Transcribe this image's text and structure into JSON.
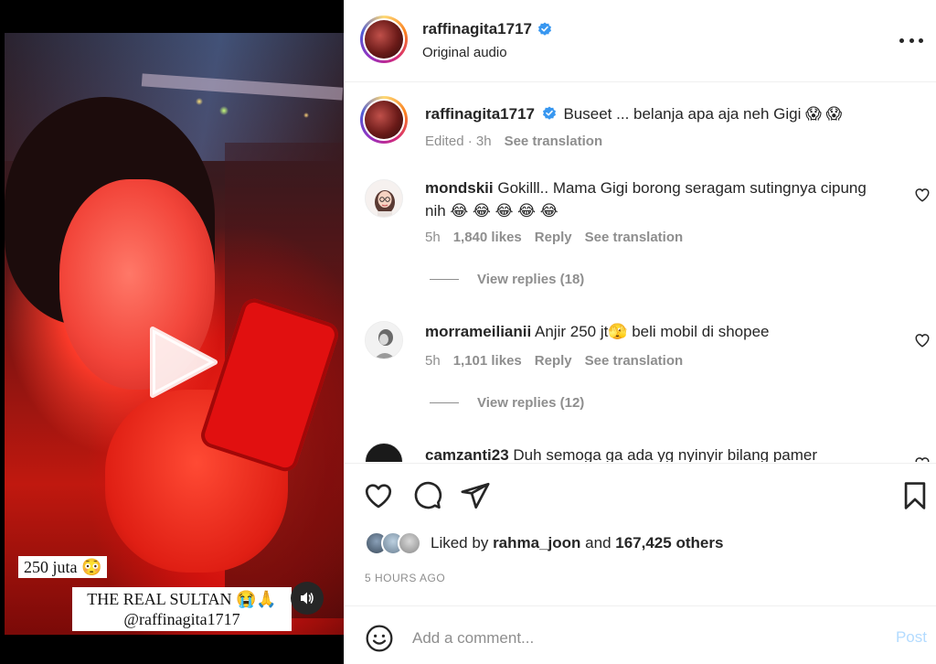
{
  "media": {
    "overlay_line1": "250 juta 😳",
    "overlay_line2": "THE REAL SULTAN 😭🙏",
    "overlay_line3": "@raffinagita1717"
  },
  "header": {
    "username": "raffinagita1717",
    "audio": "Original audio"
  },
  "caption": {
    "username": "raffinagita1717",
    "text": "Buseet ... belanja apa aja neh Gigi 😱 😱",
    "edited": "Edited",
    "time": "3h",
    "see_translation": "See translation"
  },
  "comments": [
    {
      "username": "mondskii",
      "text": "Gokilll.. Mama Gigi borong seragam sutingnya cipung nih 😂 😂 😂 😂 😂",
      "time": "5h",
      "likes": "1,840 likes",
      "reply": "Reply",
      "see_translation": "See translation",
      "view_replies": "View replies (18)"
    },
    {
      "username": "morrameilianii",
      "text": "Anjir 250 jt🫣 beli mobil di shopee",
      "time": "5h",
      "likes": "1,101 likes",
      "reply": "Reply",
      "see_translation": "See translation",
      "view_replies": "View replies (12)"
    },
    {
      "username": "camzanti23",
      "text": "Duh semoga ga ada yg nyinyir bilang pamer"
    }
  ],
  "likes": {
    "prefix": "Liked by",
    "user": "rahma_joon",
    "and": "and",
    "others": "167,425 others"
  },
  "time_ago": "5 HOURS AGO",
  "add_comment": {
    "placeholder": "Add a comment...",
    "post_label": "Post"
  },
  "colors": {
    "verified": "#3897f0",
    "post_disabled": "#b3dbff",
    "muted_text": "#8e8e8e"
  }
}
